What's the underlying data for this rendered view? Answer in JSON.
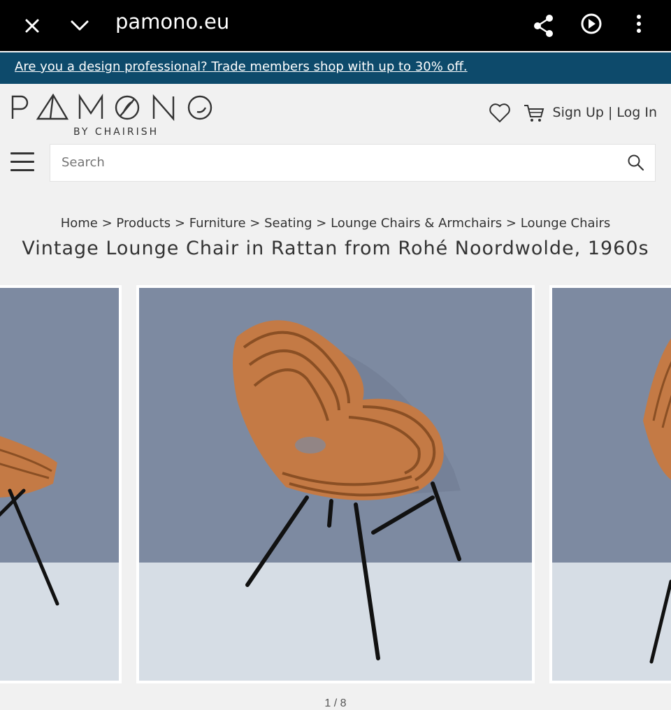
{
  "browser": {
    "url": "pamono.eu",
    "icons": [
      "close-icon",
      "chevron-down-icon",
      "share-icon",
      "play-circle-icon",
      "more-vert-icon"
    ]
  },
  "trade_banner": {
    "text": "Are you a design professional? Trade members shop with up to 30% off."
  },
  "header": {
    "logo_text": "PAMONO",
    "logo_sub": "BY CHAIRISH",
    "signup": "Sign Up",
    "separator": "|",
    "login": "Log In"
  },
  "search": {
    "placeholder": "Search"
  },
  "breadcrumb": {
    "items": [
      "Home",
      "Products",
      "Furniture",
      "Seating",
      "Lounge Chairs & Armchairs",
      "Lounge Chairs"
    ],
    "divider": ">"
  },
  "product": {
    "title": "Vintage Lounge Chair in Rattan from Rohé Noordwolde, 1960s"
  },
  "gallery": {
    "counter": "1 / 8"
  },
  "colors": {
    "trade_banner": "#0d4a6b",
    "wall": "#7d8aa1",
    "floor": "#d6dde5",
    "rattan": "#c47a45",
    "legs": "#111111"
  }
}
